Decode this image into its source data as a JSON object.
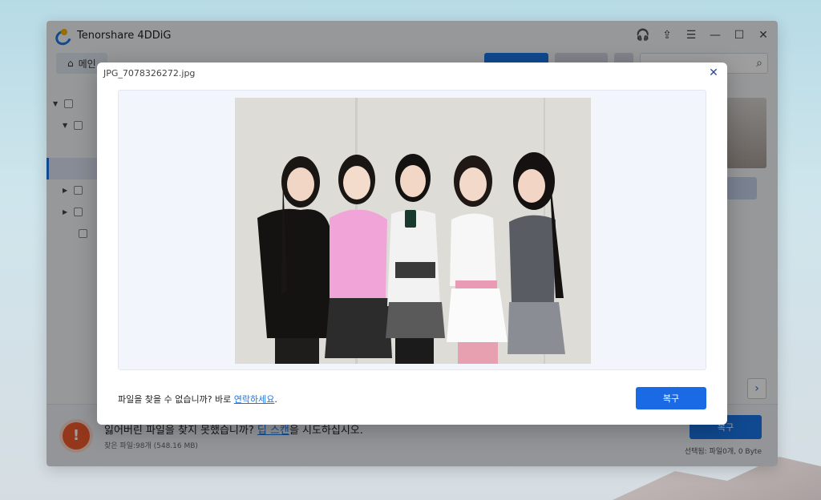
{
  "app": {
    "title": "Tenorshare 4DDiG",
    "home_tab_label": "메인"
  },
  "bottom_bar": {
    "message_prefix": "잃어버린 파일을 찾지 못했습니까? ",
    "deep_scan_link": "딥 스캔",
    "message_suffix": "을 시도하십시오.",
    "found_files": "찾은 파일:98개 (548.16 MB)",
    "recover_label": "복구",
    "selected_info": "선택됨: 파일0개, 0 Byte"
  },
  "modal": {
    "file_name": "JPG_7078326272.jpg",
    "footer_prefix": "파일을 찾을 수 없습니까? 바로 ",
    "contact_link": "연락하세요",
    "footer_suffix": ".",
    "recover_label": "복구"
  },
  "icons": {
    "headset": "headset-icon",
    "share": "share-icon",
    "menu": "menu-icon",
    "minimize": "minimize-icon",
    "maximize": "maximize-icon",
    "close": "close-icon",
    "search": "search-icon",
    "home": "home-icon",
    "warning": "warning-icon"
  },
  "colors": {
    "accent": "#1a76e8",
    "warning": "#ef5a2c"
  }
}
